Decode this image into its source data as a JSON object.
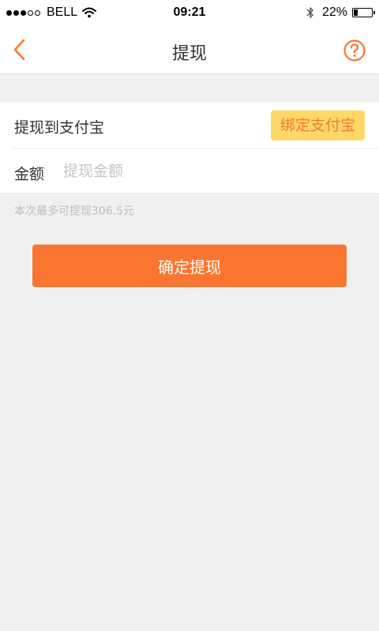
{
  "status_bar": {
    "signal_full": 3,
    "signal_total": 5,
    "carrier": "BELL",
    "wifi_icon": "wifi-icon",
    "time": "09:21",
    "bluetooth_icon": "bluetooth-icon",
    "battery_percent": "22%",
    "battery_level": 0.22
  },
  "nav": {
    "title": "提现",
    "back_icon": "chevron-left-icon",
    "help_icon": "question-circle-icon"
  },
  "form": {
    "alipay_label": "提现到支付宝",
    "bind_button_label": "绑定支付宝",
    "amount_label": "金额",
    "amount_value": "",
    "amount_placeholder": "提现金额"
  },
  "limit_hint": "本次最多可提现306.5元",
  "confirm_button_label": "确定提现",
  "colors": {
    "accent": "#fa7630",
    "bind_button_bg": "#fed766",
    "bind_button_text": "#f47a33",
    "page_bg": "#f0f0f0"
  }
}
